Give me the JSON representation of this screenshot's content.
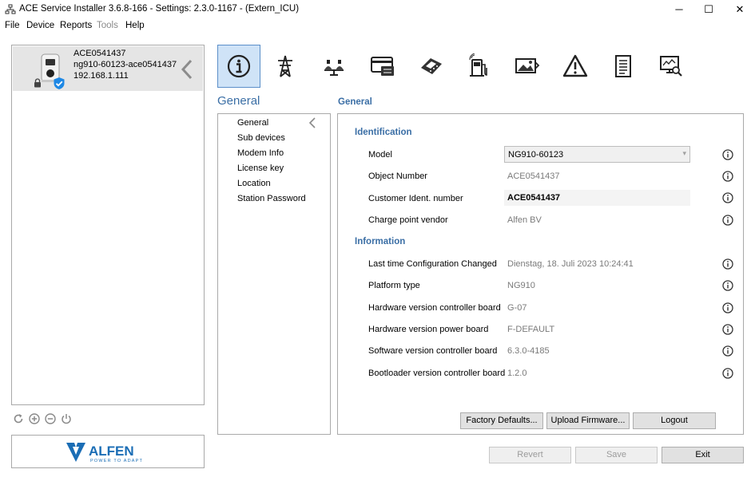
{
  "window": {
    "title": "ACE Service Installer 3.6.8-166 - Settings: 2.3.0-1167 -  (Extern_ICU)",
    "minimize": "─",
    "maximize": "☐",
    "close": "✕"
  },
  "menu": {
    "items": [
      {
        "label": "File",
        "enabled": true
      },
      {
        "label": "Device",
        "enabled": true
      },
      {
        "label": "Reports",
        "enabled": true
      },
      {
        "label": "Tools",
        "enabled": false
      },
      {
        "label": "Help",
        "enabled": true
      }
    ]
  },
  "device": {
    "name": "ACE0541437",
    "id": "ng910-60123-ace0541437",
    "ip": "192.168.1.111",
    "icon": "charger-icon",
    "status_icon": "checkmark-shield-icon",
    "lock_icon": "lock-icon"
  },
  "left_tools": [
    "refresh-icon",
    "add-icon",
    "remove-icon",
    "power-icon"
  ],
  "brand": {
    "name": "ALFEN",
    "tagline": "POWER TO ADAPT",
    "color": "#1a6db5"
  },
  "toolbar": {
    "icons": [
      "info-icon",
      "power-tower-icon",
      "balance-icon",
      "card-reader-icon",
      "payment-terminal-icon",
      "charging-station-icon",
      "display-icon",
      "warning-icon",
      "document-icon",
      "diagnostics-icon"
    ],
    "selected": 0
  },
  "section": {
    "title": "General",
    "panel_title": "General"
  },
  "subnav": {
    "items": [
      "General",
      "Sub devices",
      "Modem Info",
      "License key",
      "Location",
      "Station Password"
    ]
  },
  "identification": {
    "heading": "Identification",
    "model_label": "Model",
    "model_value": "NG910-60123",
    "object_number_label": "Object Number",
    "object_number_value": "ACE0541437",
    "customer_ident_label": "Customer Ident. number",
    "customer_ident_value": "ACE0541437",
    "vendor_label": "Charge point vendor",
    "vendor_value": "Alfen BV"
  },
  "information": {
    "heading": "Information",
    "rows": [
      {
        "label": "Last time Configuration Changed",
        "value": "Dienstag, 18. Juli 2023 10:24:41"
      },
      {
        "label": "Platform type",
        "value": "NG910"
      },
      {
        "label": "Hardware version controller board",
        "value": "G-07"
      },
      {
        "label": "Hardware version power board",
        "value": "F-DEFAULT"
      },
      {
        "label": "Software version controller board",
        "value": "6.3.0-4185"
      },
      {
        "label": "Bootloader version controller board",
        "value": "1.2.0"
      }
    ]
  },
  "actions": {
    "factory_defaults": "Factory Defaults...",
    "upload_firmware": "Upload Firmware...",
    "logout": "Logout"
  },
  "footer": {
    "revert": "Revert",
    "save": "Save",
    "exit": "Exit"
  },
  "colors": {
    "accent": "#3a6ea5",
    "selected_bg": "#cfe3f7",
    "selected_border": "#5b8fc9"
  }
}
